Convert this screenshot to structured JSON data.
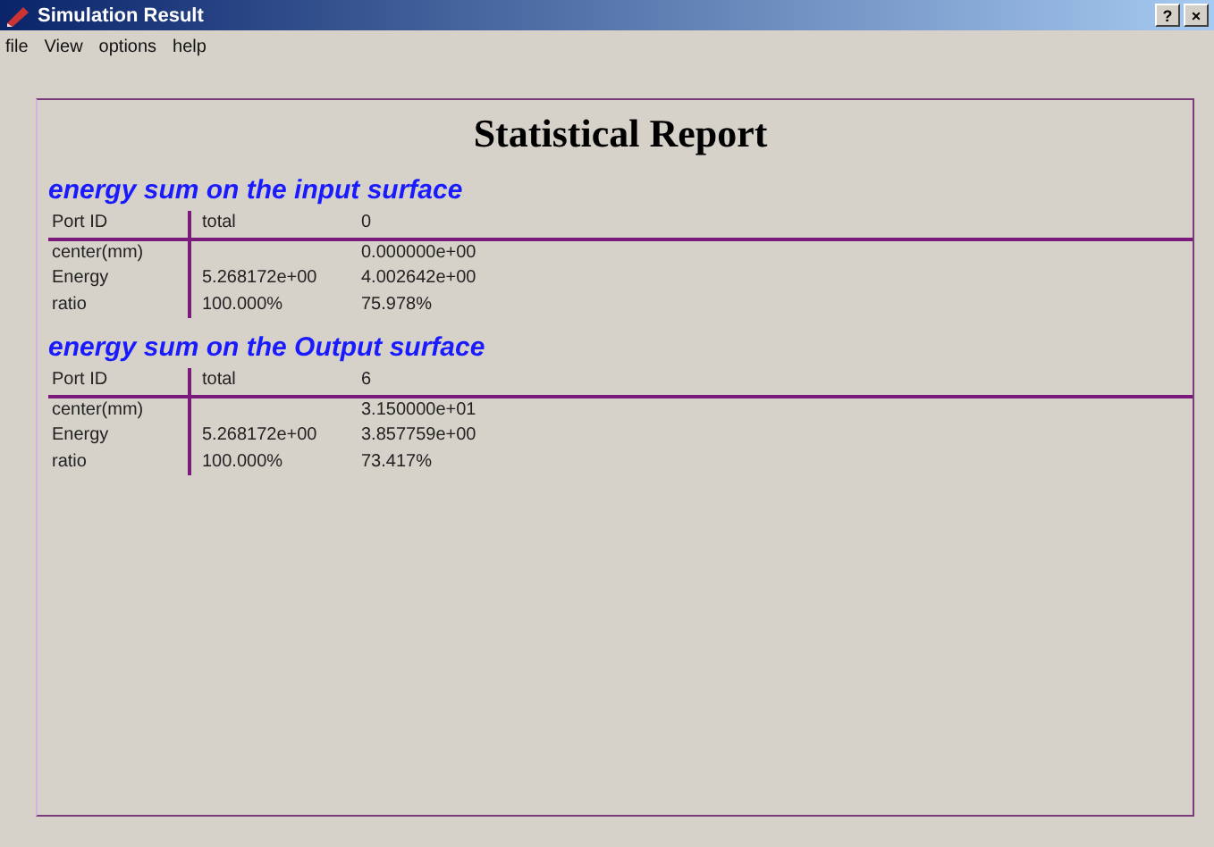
{
  "window": {
    "title": "Simulation Result",
    "buttons": [
      "?",
      "×"
    ]
  },
  "menu": [
    "file",
    "View",
    "options",
    "help"
  ],
  "report": {
    "title": "Statistical Report",
    "sections": [
      {
        "heading": "energy sum on the input surface",
        "columns": [
          "Port ID",
          "total",
          "0"
        ],
        "rows": [
          [
            "center(mm)",
            "",
            "0.000000e+00"
          ],
          [
            "Energy",
            "5.268172e+00",
            "4.002642e+00"
          ],
          [
            "ratio",
            "100.000%",
            "75.978%"
          ]
        ]
      },
      {
        "heading": "energy sum on the Output surface",
        "columns": [
          "Port ID",
          "total",
          "6"
        ],
        "rows": [
          [
            "center(mm)",
            "",
            "3.150000e+01"
          ],
          [
            "Energy",
            "5.268172e+00",
            "3.857759e+00"
          ],
          [
            "ratio",
            "100.000%",
            "73.417%"
          ]
        ]
      }
    ]
  }
}
